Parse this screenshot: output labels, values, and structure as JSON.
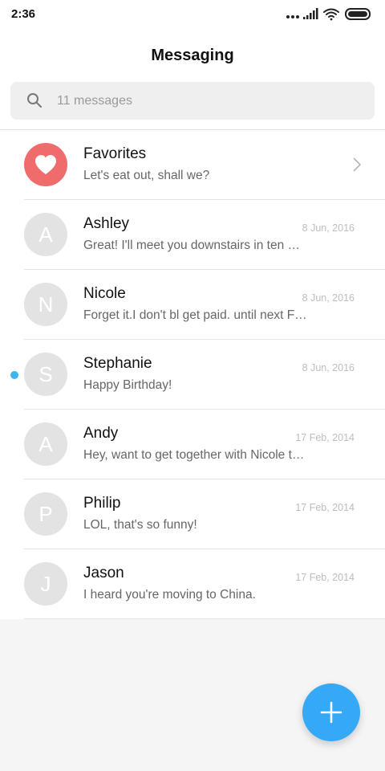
{
  "status_bar": {
    "time": "2:36"
  },
  "header": {
    "title": "Messaging"
  },
  "search": {
    "placeholder": "11 messages"
  },
  "colors": {
    "favorite": "#f06b6b",
    "unread_dot": "#3ab6f0",
    "fab": "#35a9f5"
  },
  "favorites": {
    "name": "Favorites",
    "preview": "Let's eat out, shall we?",
    "icon": "heart-icon"
  },
  "conversations": [
    {
      "initial": "A",
      "name": "Ashley",
      "date": "8 Jun, 2016",
      "preview": "Great! I'll meet you downstairs in ten minutes.",
      "unread": false
    },
    {
      "initial": "N",
      "name": "Nicole",
      "date": "8 Jun, 2016",
      "preview": "Forget it.I don't bl get paid. until next Friday.",
      "unread": false
    },
    {
      "initial": "S",
      "name": "Stephanie",
      "date": "8 Jun, 2016",
      "preview": "Happy Birthday!",
      "unread": true
    },
    {
      "initial": "A",
      "name": "Andy",
      "date": "17 Feb, 2014",
      "preview": "Hey, want to get together with Nicole tonight?",
      "unread": false
    },
    {
      "initial": "P",
      "name": "Philip",
      "date": "17 Feb, 2014",
      "preview": "LOL, that's so funny!",
      "unread": false
    },
    {
      "initial": "J",
      "name": "Jason",
      "date": "17 Feb, 2014",
      "preview": "I heard you're moving to China.",
      "unread": false
    }
  ],
  "fab": {
    "icon": "plus-icon"
  }
}
